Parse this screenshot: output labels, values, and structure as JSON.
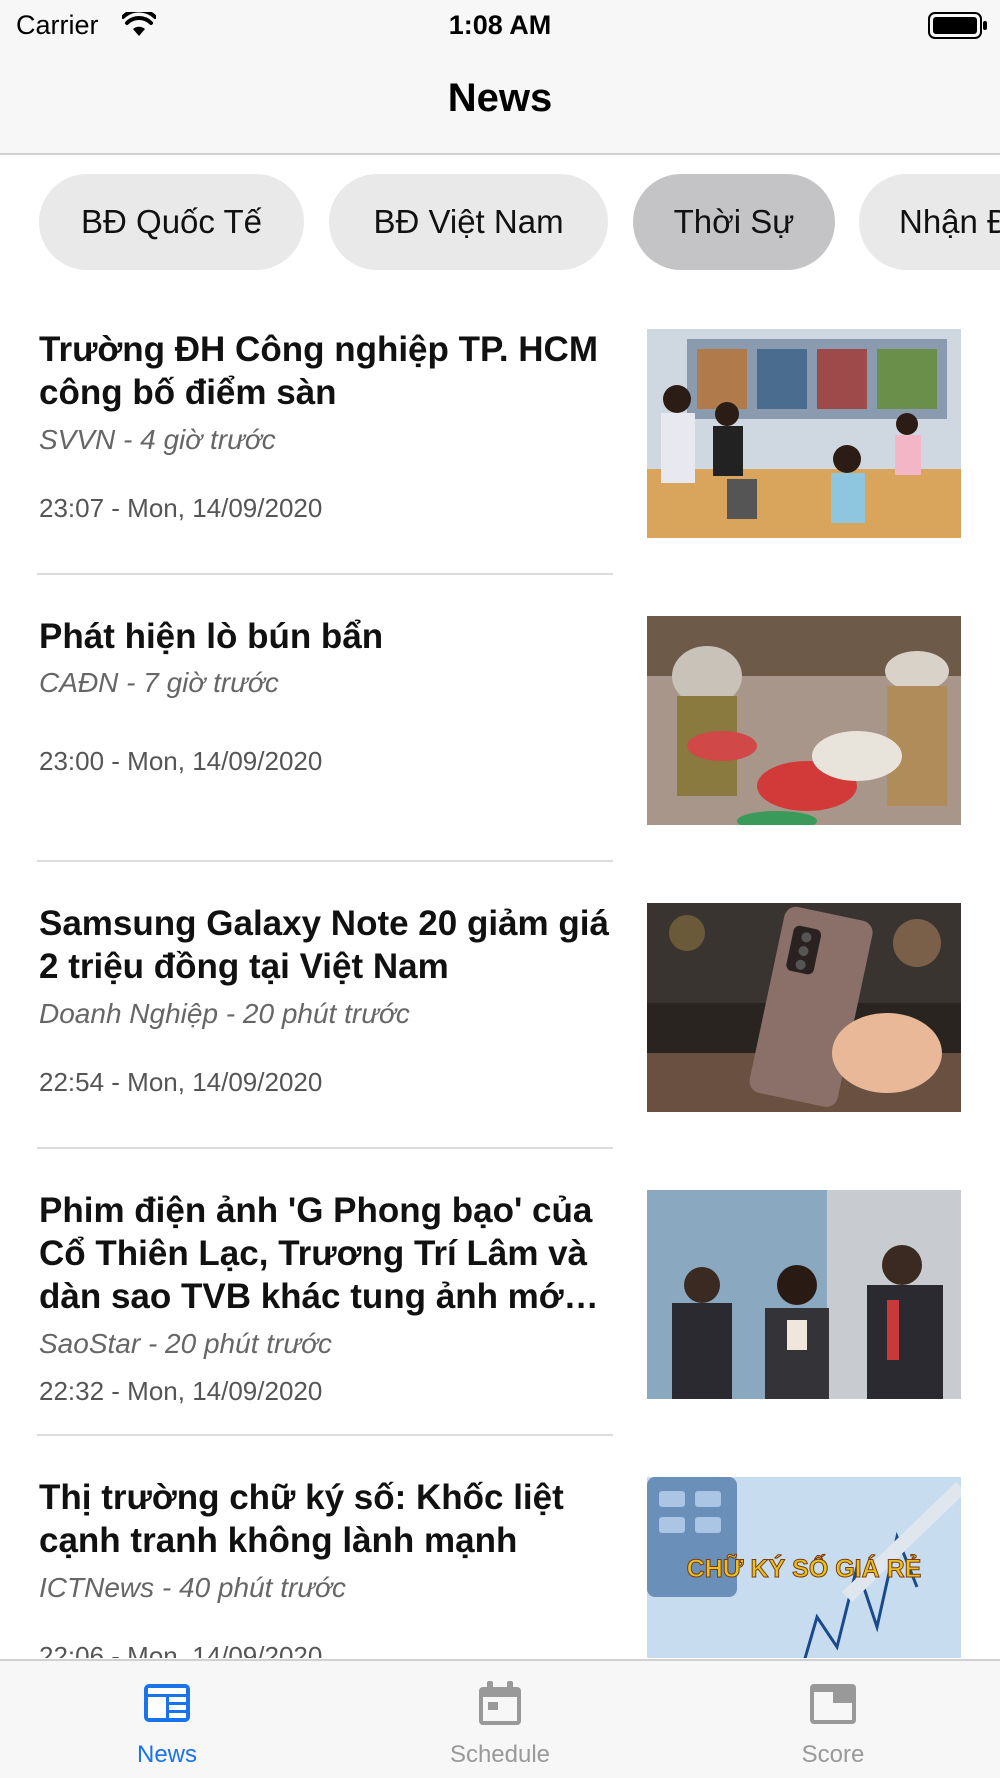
{
  "status_bar": {
    "carrier": "Carrier",
    "time": "1:08 AM"
  },
  "nav": {
    "title": "News"
  },
  "categories": [
    {
      "label": "BĐ Quốc Tế",
      "active": false
    },
    {
      "label": "BĐ Việt Nam",
      "active": false
    },
    {
      "label": "Thời Sự",
      "active": true
    },
    {
      "label": "Nhận Đ",
      "active": false
    }
  ],
  "news": [
    {
      "title": "Trường ĐH Công nghiệp TP. HCM công bố điểm sàn",
      "source": "SVVN - 4 giờ trước",
      "time": "23:07 - Mon, 14/09/2020",
      "image": "library-photo"
    },
    {
      "title": "Phát hiện lò bún bẩn",
      "source": "CAĐN - 7 giờ trước",
      "time": "23:00 - Mon, 14/09/2020",
      "image": "noodle-factory-photo"
    },
    {
      "title": "Samsung Galaxy Note 20 giảm giá 2 triệu đồng tại Việt Nam",
      "source": "Doanh Nghiệp - 20 phút trước",
      "time": "22:54 - Mon, 14/09/2020",
      "image": "phone-photo"
    },
    {
      "title": "Phim điện ảnh 'G Phong bạo' của Cổ Thiên Lạc, Trương Trí Lâm và dàn sao TVB khác tung ảnh mớ…",
      "source": "SaoStar - 20 phút trước",
      "time": "22:32 - Mon, 14/09/2020",
      "image": "movie-still-photo"
    },
    {
      "title": "Thị trường chữ ký số: Khốc liệt cạnh tranh không lành mạnh",
      "source": "ICTNews - 40 phút trước",
      "time": "22:06 - Mon, 14/09/2020",
      "image": "signature-photo",
      "image_caption": "CHỮ KÝ SỐ GIÁ RẺ"
    }
  ],
  "tabs": [
    {
      "label": "News",
      "icon": "newspaper-icon",
      "active": true
    },
    {
      "label": "Schedule",
      "icon": "calendar-icon",
      "active": false
    },
    {
      "label": "Score",
      "icon": "scoreboard-icon",
      "active": false
    }
  ],
  "colors": {
    "accent": "#1a73e8",
    "inactive": "#999999",
    "chip": "#e9e9ea",
    "chip_active": "#c4c4c6"
  }
}
